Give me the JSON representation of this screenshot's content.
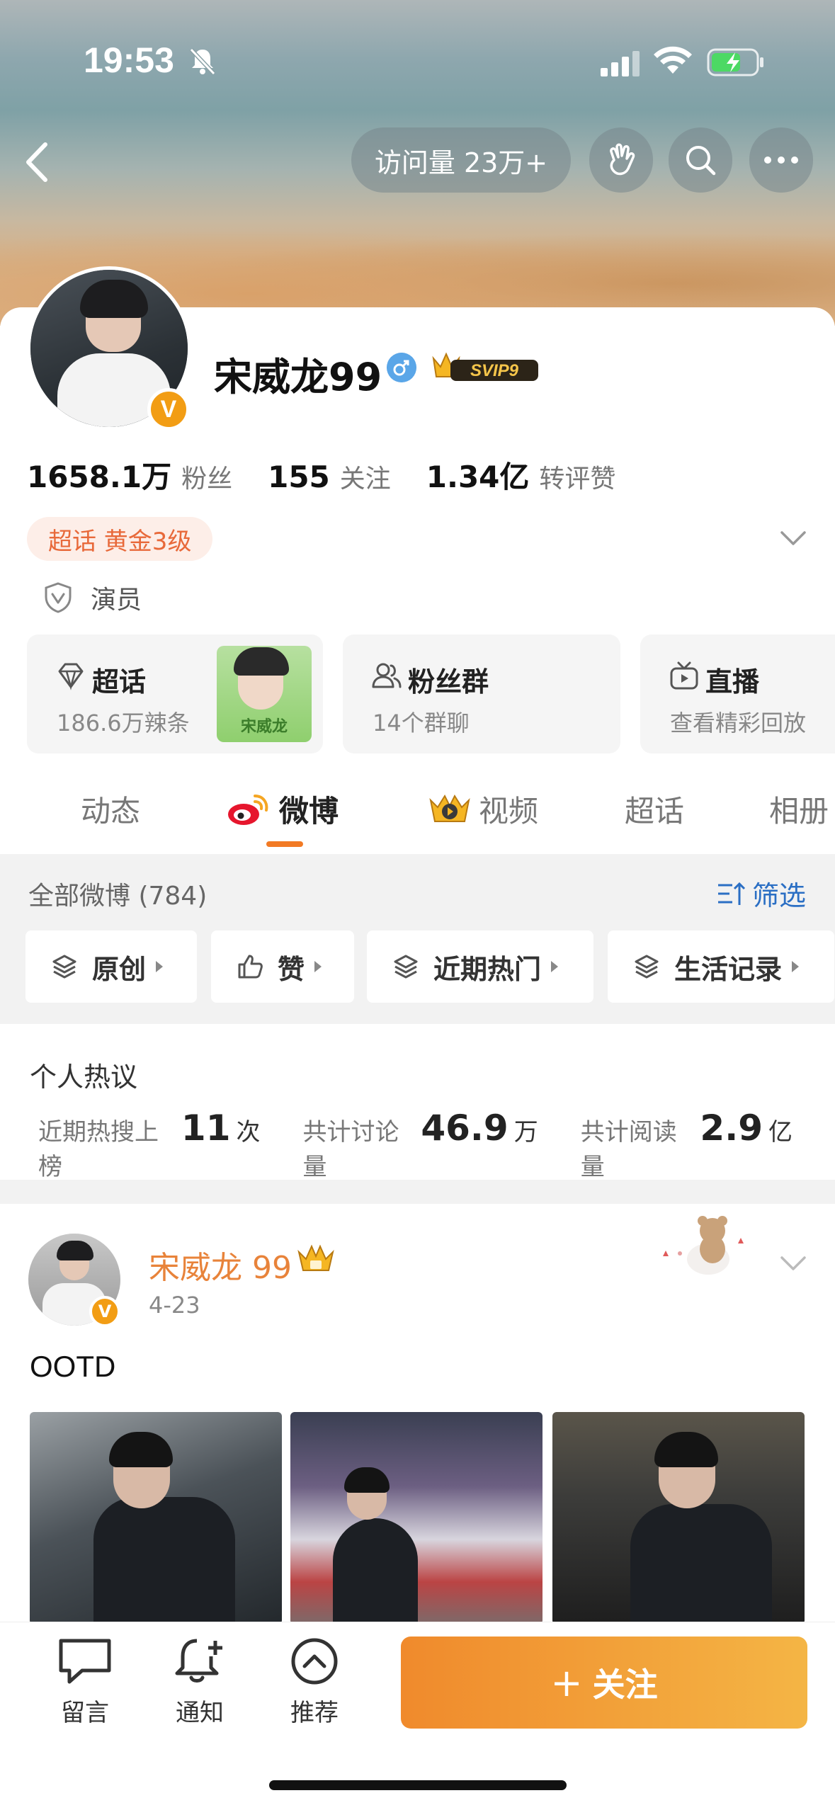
{
  "status_bar": {
    "time": "19:53"
  },
  "header": {
    "visit_label": "访问量 23万+"
  },
  "profile": {
    "name": "宋威龙99",
    "vip_badge": "SVIP9",
    "verified_badge": "V",
    "stats": [
      {
        "value": "1658.1万",
        "label": "粉丝"
      },
      {
        "value": "155",
        "label": "关注"
      },
      {
        "value": "1.34亿",
        "label": "转评赞"
      }
    ],
    "super_badge": "超话 黄金3级",
    "occupation": "演员"
  },
  "tiles": [
    {
      "title": "超话",
      "subtitle": "186.6万辣条",
      "thumb_text": "宋威龙",
      "icon": "diamond-icon"
    },
    {
      "title": "粉丝群",
      "subtitle": "14个群聊",
      "icon": "group-icon"
    },
    {
      "title": "直播",
      "subtitle": "查看精彩回放",
      "icon": "tv-icon"
    }
  ],
  "tabs": [
    {
      "label": "动态",
      "active": false
    },
    {
      "label": "微博",
      "active": true,
      "icon": "weibo-icon"
    },
    {
      "label": "视频",
      "active": false,
      "icon": "video-icon"
    },
    {
      "label": "超话",
      "active": false
    },
    {
      "label": "相册",
      "active": false
    }
  ],
  "filter": {
    "all_posts": "全部微博 (784)",
    "filter_label": "筛选",
    "chips": [
      {
        "label": "原创"
      },
      {
        "label": "赞"
      },
      {
        "label": "近期热门"
      },
      {
        "label": "生活记录"
      }
    ]
  },
  "hot_discussion": {
    "title": "个人热议",
    "items": [
      {
        "label": "近期热搜上榜",
        "value": "11",
        "unit": "次"
      },
      {
        "label": "共计讨论量",
        "value": "46.9",
        "unit": "万"
      },
      {
        "label": "共计阅读量",
        "value": "2.9",
        "unit": "亿"
      }
    ]
  },
  "post": {
    "author": "宋威龙 99",
    "date": "4-23",
    "text": "OOTD",
    "verified_badge": "V"
  },
  "toolbar": {
    "items": [
      {
        "label": "留言",
        "icon": "message-icon"
      },
      {
        "label": "通知",
        "icon": "bell-plus-icon"
      },
      {
        "label": "推荐",
        "icon": "recommend-icon"
      }
    ],
    "follow_plus": "+",
    "follow_label": "关注"
  },
  "colors": {
    "accent": "#f27a24",
    "link": "#2b6fc4",
    "follow_start": "#f08a2c",
    "follow_end": "#f4b545"
  }
}
